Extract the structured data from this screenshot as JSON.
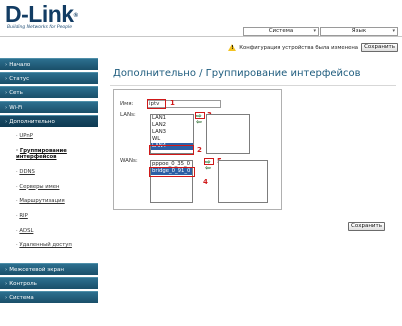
{
  "brand": {
    "logo": "D-Link",
    "reg": "®",
    "tagline": "Building Networks for People"
  },
  "header": {
    "system_select": "Система",
    "lang_select": "Язык",
    "notice_text": "Конфигурация устройства была изменена",
    "save_button": "Сохранить"
  },
  "sidebar": {
    "items": [
      {
        "label": "Начало"
      },
      {
        "label": "Статус"
      },
      {
        "label": "Сеть"
      },
      {
        "label": "Wi-Fi"
      },
      {
        "label": "Дополнительно"
      }
    ],
    "sub_items": [
      {
        "label": "UPnP"
      },
      {
        "label": "Группирование интерфейсов"
      },
      {
        "label": "DDNS"
      },
      {
        "label": "Серверы имен"
      },
      {
        "label": "Маршрутизация"
      },
      {
        "label": "RIP"
      },
      {
        "label": "ADSL"
      },
      {
        "label": "Удаленный доступ"
      }
    ],
    "bottom_items": [
      {
        "label": "Межсетевой экран"
      },
      {
        "label": "Контроль"
      },
      {
        "label": "Система"
      }
    ]
  },
  "content": {
    "title": "Дополнительно  /  Группирование интерфейсов",
    "name_label": "Имя:",
    "name_value": "iptv",
    "lans_label": "LANs:",
    "wans_label": "WANs:",
    "lan_available": [
      "LAN1",
      "LAN2",
      "LAN3",
      "WL",
      "LAN4"
    ],
    "lan_selected_index": 4,
    "wan_available": [
      "pppoe_0_35_0",
      "bridge_0_91_0"
    ],
    "wan_selected_index": 1,
    "arrow_right": "⇨",
    "arrow_left": "⇦",
    "annotations": [
      "1",
      "2",
      "3",
      "4",
      "5"
    ],
    "save_button": "Сохранить"
  },
  "colors": {
    "brand": "#123c63",
    "nav_bg": "#1f5a76",
    "title": "#1d5b7d",
    "annotation": "#d01919",
    "selection": "#2c5fa5"
  }
}
